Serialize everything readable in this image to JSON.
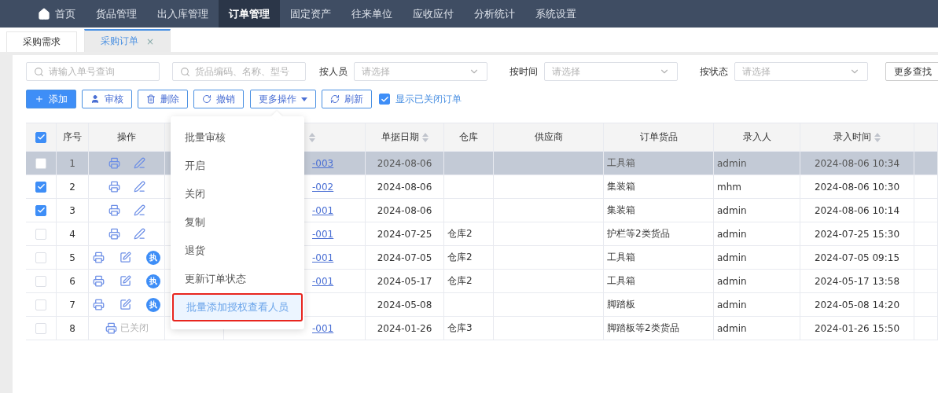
{
  "nav": {
    "items": [
      {
        "label": "首页",
        "selected": false
      },
      {
        "label": "货品管理",
        "selected": false
      },
      {
        "label": "出入库管理",
        "selected": false
      },
      {
        "label": "订单管理",
        "selected": true
      },
      {
        "label": "固定资产",
        "selected": false
      },
      {
        "label": "往来单位",
        "selected": false
      },
      {
        "label": "应收应付",
        "selected": false
      },
      {
        "label": "分析统计",
        "selected": false
      },
      {
        "label": "系统设置",
        "selected": false
      }
    ]
  },
  "tabs": [
    {
      "label": "采购需求",
      "selected": false
    },
    {
      "label": "采购订单",
      "selected": true,
      "close": "×"
    }
  ],
  "filters": {
    "order_search": {
      "placeholder": "请输入单号查询"
    },
    "goods_search": {
      "placeholder": "货品编码、名称、型号"
    },
    "selects": [
      {
        "label": "按人员",
        "placeholder": "请选择"
      },
      {
        "label": "按时间",
        "placeholder": "请选择"
      },
      {
        "label": "按状态",
        "placeholder": "请选择"
      }
    ],
    "more": "更多查找"
  },
  "toolbar": {
    "buttons": [
      {
        "label": "添加",
        "kind": "add"
      },
      {
        "label": "审核",
        "kind": "approve"
      },
      {
        "label": "删除",
        "kind": "delete"
      },
      {
        "label": "撤销",
        "kind": "undo"
      },
      {
        "label": "更多操作",
        "kind": "more"
      },
      {
        "label": "刷新",
        "kind": "refresh"
      }
    ],
    "show_closed": {
      "label": "显示已关闭订单",
      "checked": true
    }
  },
  "table": {
    "all_checked": true,
    "columns": [
      {
        "label": "序号",
        "sortable": false
      },
      {
        "label": "操作",
        "sortable": false
      },
      {
        "sortable": true
      },
      {
        "label": "单据日期",
        "sortable": true
      },
      {
        "label": "仓库",
        "sortable": false
      },
      {
        "label": "供应商",
        "sortable": false
      },
      {
        "label": "订单货品",
        "sortable": false
      },
      {
        "label": "录入人",
        "sortable": false
      },
      {
        "label": "录入时间",
        "sortable": true
      },
      {
        "sortable": false
      }
    ],
    "rows": [
      {
        "checked": false,
        "hovered": true,
        "index": "1",
        "actions": [
          {
            "kind": "print"
          },
          {
            "kind": "pencil"
          }
        ],
        "order_no": "-003",
        "date": "2024-08-06",
        "warehouse": "",
        "goods": "工具箱",
        "creator": "admin",
        "created": "2024-08-06 10:34"
      },
      {
        "checked": true,
        "hovered": false,
        "index": "2",
        "actions": [
          {
            "kind": "print"
          },
          {
            "kind": "pencil"
          }
        ],
        "order_no": "-002",
        "date": "2024-08-06",
        "warehouse": "",
        "goods": "集装箱",
        "creator": "mhm",
        "created": "2024-08-06 10:30"
      },
      {
        "checked": true,
        "hovered": false,
        "index": "3",
        "actions": [
          {
            "kind": "print"
          },
          {
            "kind": "pencil"
          }
        ],
        "order_no": "-001",
        "date": "2024-08-06",
        "warehouse": "",
        "goods": "集装箱",
        "creator": "admin",
        "created": "2024-08-06 10:14"
      },
      {
        "checked": false,
        "hovered": false,
        "index": "4",
        "actions": [
          {
            "kind": "print"
          },
          {
            "kind": "pencil"
          }
        ],
        "order_no": "-001",
        "date": "2024-07-25",
        "warehouse": "仓库2",
        "goods": "护栏等2类货品",
        "creator": "admin",
        "created": "2024-07-25 15:30"
      },
      {
        "checked": false,
        "hovered": false,
        "index": "5",
        "actions": [
          {
            "kind": "print"
          },
          {
            "kind": "edit"
          },
          {
            "kind": "badge",
            "label": "执"
          }
        ],
        "order_no": "-001",
        "date": "2024-07-05",
        "warehouse": "仓库2",
        "goods": "工具箱",
        "creator": "admin",
        "created": "2024-07-05 09:15"
      },
      {
        "checked": false,
        "hovered": false,
        "index": "6",
        "actions": [
          {
            "kind": "print"
          },
          {
            "kind": "edit"
          },
          {
            "kind": "badge",
            "label": "执"
          }
        ],
        "order_no": "-001",
        "date": "2024-05-17",
        "warehouse": "仓库2",
        "goods": "工具箱",
        "creator": "admin",
        "created": "2024-05-17 13:58"
      },
      {
        "checked": false,
        "hovered": false,
        "index": "7",
        "actions": [
          {
            "kind": "print"
          },
          {
            "kind": "edit"
          },
          {
            "kind": "badge",
            "label": "执"
          }
        ],
        "order_no": "",
        "date": "2024-05-08",
        "warehouse": "",
        "goods": "脚踏板",
        "creator": "admin",
        "created": "2024-05-08 14:20"
      },
      {
        "checked": false,
        "hovered": false,
        "index": "8",
        "actions": [
          {
            "kind": "print"
          },
          {
            "kind": "status",
            "label": "已关闭"
          }
        ],
        "order_no": "-001",
        "date": "2024-01-26",
        "warehouse": "仓库3",
        "goods": "脚踏板等2类货品",
        "creator": "admin",
        "created": "2024-01-26 15:50"
      }
    ]
  },
  "more_menu": {
    "items": [
      {
        "label": "批量审核",
        "selected": false,
        "annotated": false
      },
      {
        "label": "开启",
        "selected": false,
        "annotated": false
      },
      {
        "label": "关闭",
        "selected": false,
        "annotated": false
      },
      {
        "label": "复制",
        "selected": false,
        "annotated": false
      },
      {
        "label": "退货",
        "selected": false,
        "annotated": false
      },
      {
        "label": "更新订单状态",
        "selected": false,
        "annotated": false
      },
      {
        "label": "批量添加授权查看人员",
        "selected": true,
        "annotated": true
      }
    ]
  }
}
